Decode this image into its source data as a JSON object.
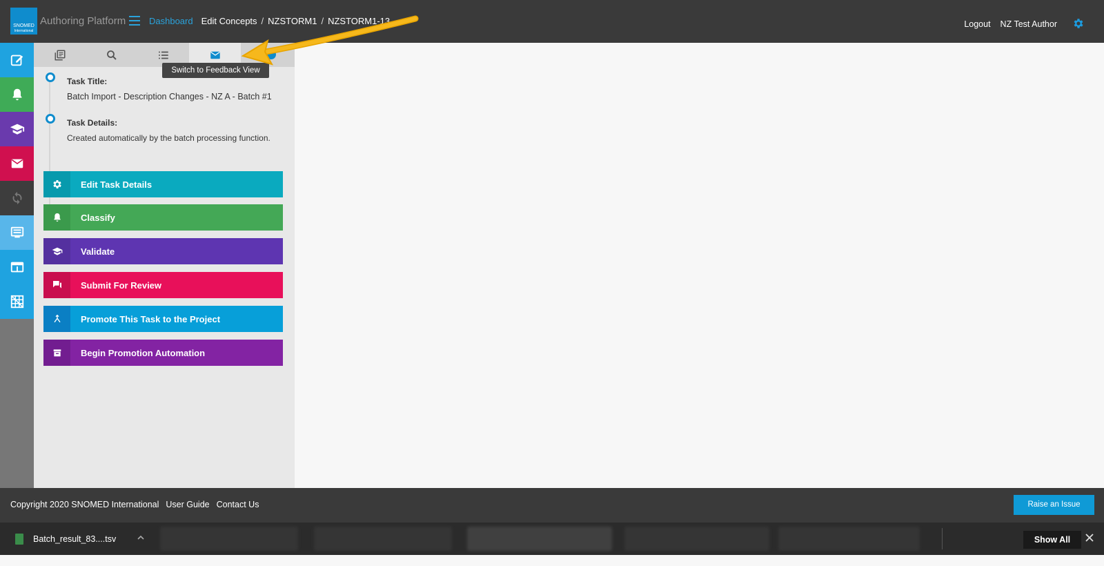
{
  "header": {
    "logo_text": "SNOMED",
    "logo_subtext": "International",
    "app_title": "Authoring Platform",
    "breadcrumb": [
      "Dashboard",
      "Edit Concepts",
      "NZSTORM1",
      "NZSTORM1-13"
    ],
    "logout_label": "Logout",
    "user_name": "NZ Test Author"
  },
  "leftnav": {
    "items": [
      {
        "name": "edit",
        "icon": "pencil-square-icon",
        "color": "#1fa3e0"
      },
      {
        "name": "classify",
        "icon": "bell-icon",
        "color": "#3fab57"
      },
      {
        "name": "validate",
        "icon": "mortarboard-icon",
        "color": "#6a3aad"
      },
      {
        "name": "feedback",
        "icon": "envelope-icon",
        "color": "#d0104f"
      },
      {
        "name": "sync",
        "icon": "sync-icon",
        "color": "#3d3d3d"
      },
      {
        "name": "list",
        "icon": "list-view-icon",
        "color": "#58b6ea"
      },
      {
        "name": "window",
        "icon": "window-icon",
        "color": "#1fa3e0"
      },
      {
        "name": "grid",
        "icon": "grid-icon",
        "color": "#1fa3e0"
      }
    ]
  },
  "panel": {
    "tabs": [
      "library-icon",
      "search-icon",
      "list-icon",
      "feedback-envelope-icon"
    ],
    "tooltip": "Switch to Feedback View",
    "task_title_label": "Task Title:",
    "task_title_value": "Batch Import - Description Changes - NZ A - Batch #1",
    "task_details_label": "Task Details:",
    "task_details_value": "Created automatically by the batch processing function.",
    "actions": [
      {
        "label": "Edit Task Details",
        "icon": "gear-icon",
        "color": "#0aaabf",
        "icon_bg": "#079aad"
      },
      {
        "label": "Classify",
        "icon": "bell-icon",
        "color": "#44a856",
        "icon_bg": "#3b9a4c"
      },
      {
        "label": "Validate",
        "icon": "mortarboard-icon",
        "color": "#5e35b1",
        "icon_bg": "#54309f"
      },
      {
        "label": "Submit For Review",
        "icon": "chat-icon",
        "color": "#e8105a",
        "icon_bg": "#c90e4e"
      },
      {
        "label": "Promote This Task to the Project",
        "icon": "merge-icon",
        "color": "#079fd9",
        "icon_bg": "#0a7fc4"
      },
      {
        "label": "Begin Promotion Automation",
        "icon": "archive-icon",
        "color": "#8323a3",
        "icon_bg": "#721d90"
      }
    ]
  },
  "footer": {
    "copyright": "Copyright 2020 SNOMED International",
    "user_guide": "User Guide",
    "contact_us": "Contact Us",
    "raise_issue": "Raise an Issue"
  },
  "downloads": {
    "file_name": "Batch_result_83....tsv",
    "show_all": "Show All"
  }
}
